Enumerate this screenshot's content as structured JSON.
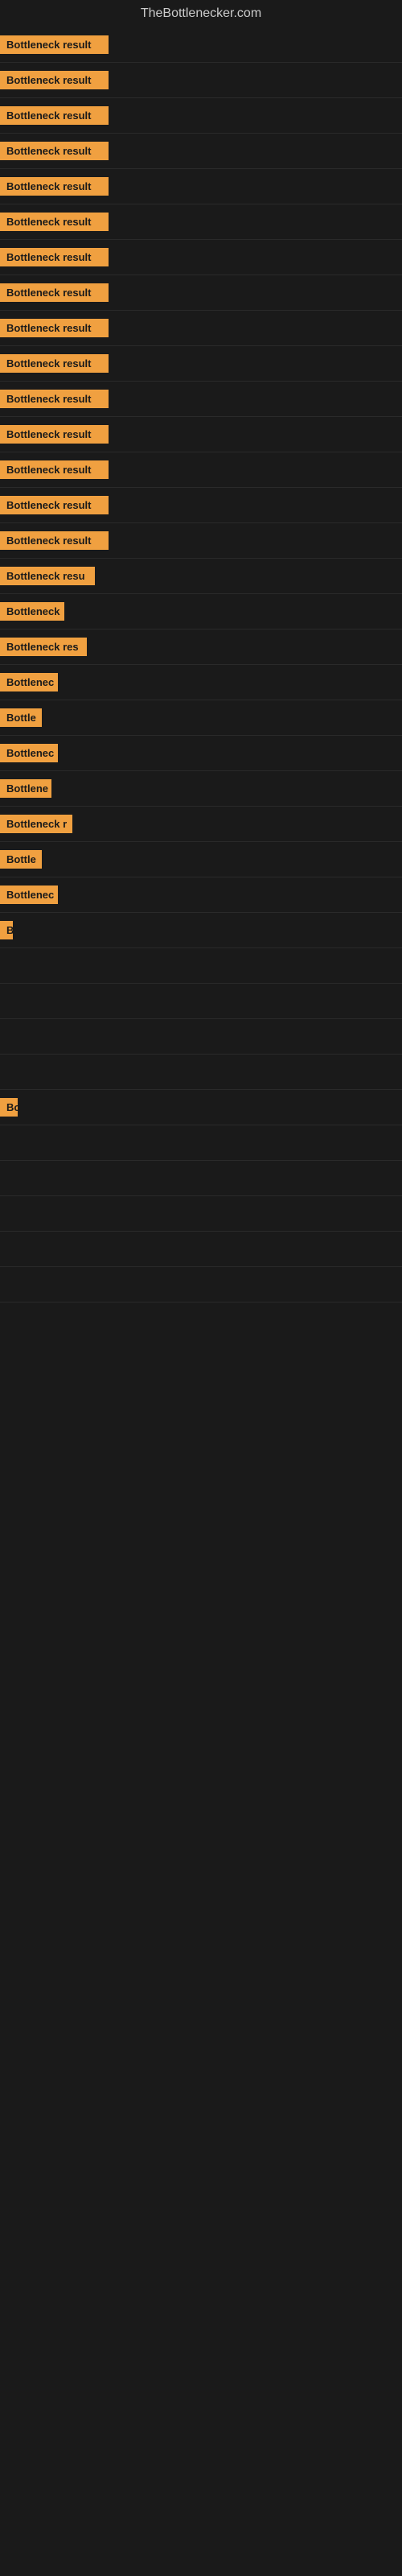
{
  "site": {
    "title": "TheBottlenecker.com"
  },
  "rows": [
    {
      "id": 1,
      "label": "Bottleneck result",
      "width": 135
    },
    {
      "id": 2,
      "label": "Bottleneck result",
      "width": 135
    },
    {
      "id": 3,
      "label": "Bottleneck result",
      "width": 135
    },
    {
      "id": 4,
      "label": "Bottleneck result",
      "width": 135
    },
    {
      "id": 5,
      "label": "Bottleneck result",
      "width": 135
    },
    {
      "id": 6,
      "label": "Bottleneck result",
      "width": 135
    },
    {
      "id": 7,
      "label": "Bottleneck result",
      "width": 135
    },
    {
      "id": 8,
      "label": "Bottleneck result",
      "width": 135
    },
    {
      "id": 9,
      "label": "Bottleneck result",
      "width": 135
    },
    {
      "id": 10,
      "label": "Bottleneck result",
      "width": 135
    },
    {
      "id": 11,
      "label": "Bottleneck result",
      "width": 135
    },
    {
      "id": 12,
      "label": "Bottleneck result",
      "width": 135
    },
    {
      "id": 13,
      "label": "Bottleneck result",
      "width": 135
    },
    {
      "id": 14,
      "label": "Bottleneck result",
      "width": 135
    },
    {
      "id": 15,
      "label": "Bottleneck result",
      "width": 135
    },
    {
      "id": 16,
      "label": "Bottleneck resu",
      "width": 118
    },
    {
      "id": 17,
      "label": "Bottleneck",
      "width": 80
    },
    {
      "id": 18,
      "label": "Bottleneck res",
      "width": 108
    },
    {
      "id": 19,
      "label": "Bottlenec",
      "width": 72
    },
    {
      "id": 20,
      "label": "Bottle",
      "width": 52
    },
    {
      "id": 21,
      "label": "Bottlenec",
      "width": 72
    },
    {
      "id": 22,
      "label": "Bottlene",
      "width": 64
    },
    {
      "id": 23,
      "label": "Bottleneck r",
      "width": 90
    },
    {
      "id": 24,
      "label": "Bottle",
      "width": 52
    },
    {
      "id": 25,
      "label": "Bottlenec",
      "width": 72
    },
    {
      "id": 26,
      "label": "B",
      "width": 14
    },
    {
      "id": 27,
      "label": "",
      "width": 0
    },
    {
      "id": 28,
      "label": "",
      "width": 0
    },
    {
      "id": 29,
      "label": "",
      "width": 0
    },
    {
      "id": 30,
      "label": "",
      "width": 0
    },
    {
      "id": 31,
      "label": "Bo",
      "width": 22
    },
    {
      "id": 32,
      "label": "",
      "width": 0
    },
    {
      "id": 33,
      "label": "",
      "width": 0
    },
    {
      "id": 34,
      "label": "",
      "width": 0
    },
    {
      "id": 35,
      "label": "",
      "width": 0
    },
    {
      "id": 36,
      "label": "",
      "width": 0
    }
  ]
}
